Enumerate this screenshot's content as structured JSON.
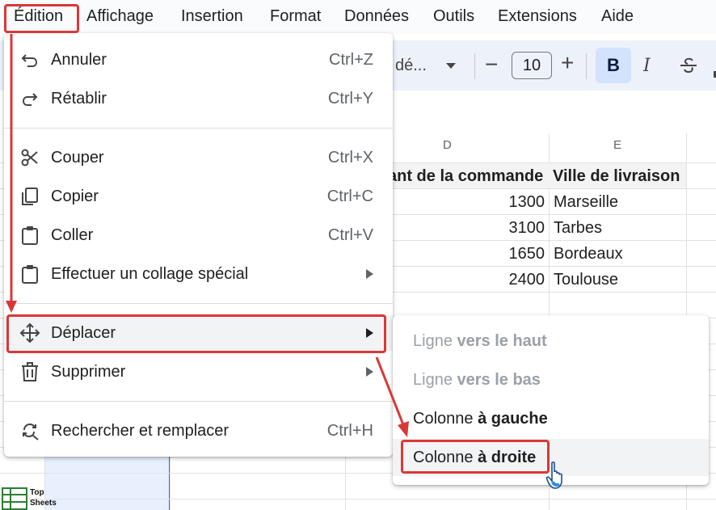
{
  "menubar": {
    "items": [
      "Édition",
      "Affichage",
      "Insertion",
      "Format",
      "Données",
      "Outils",
      "Extensions",
      "Aide"
    ]
  },
  "toolbar": {
    "font": "dé...",
    "font_size": "10",
    "bold": "B",
    "italic": "I"
  },
  "sheet": {
    "columns": [
      "D",
      "E"
    ],
    "header_row": [
      "ant de la commande",
      "Ville de livraison"
    ],
    "rows": [
      [
        "1300",
        "Marseille"
      ],
      [
        "3100",
        "Tarbes"
      ],
      [
        "1650",
        "Bordeaux"
      ],
      [
        "2400",
        "Toulouse"
      ]
    ]
  },
  "edit_menu": {
    "items": [
      {
        "label": "Annuler",
        "shortcut": "Ctrl+Z",
        "icon": "undo-icon"
      },
      {
        "label": "Rétablir",
        "shortcut": "Ctrl+Y",
        "icon": "redo-icon"
      },
      {
        "label": "Couper",
        "shortcut": "Ctrl+X",
        "icon": "scissors-icon"
      },
      {
        "label": "Copier",
        "shortcut": "Ctrl+C",
        "icon": "copy-icon"
      },
      {
        "label": "Coller",
        "shortcut": "Ctrl+V",
        "icon": "clipboard-icon"
      },
      {
        "label": "Effectuer un collage spécial",
        "shortcut": "",
        "icon": "clipboard-icon"
      },
      {
        "label": "Déplacer",
        "shortcut": "",
        "icon": "move-icon"
      },
      {
        "label": "Supprimer",
        "shortcut": "",
        "icon": "trash-icon"
      },
      {
        "label": "Rechercher et remplacer",
        "shortcut": "Ctrl+H",
        "icon": "find-replace-icon"
      }
    ]
  },
  "move_submenu": {
    "items": [
      {
        "prefix": "Ligne ",
        "bold": "vers le haut",
        "enabled": false
      },
      {
        "prefix": "Ligne ",
        "bold": "vers le bas",
        "enabled": false
      },
      {
        "prefix": "Colonne ",
        "bold": "à gauche",
        "enabled": true
      },
      {
        "prefix": "Colonne ",
        "bold": "à droite",
        "enabled": true
      }
    ]
  },
  "watermark": {
    "line1": "Top",
    "line2": "Sheets"
  },
  "colors": {
    "annotation": "#d93838",
    "menu_highlight": "#f1f3f4",
    "selection": "#1a73e8",
    "toolbar_bg": "#edf2fa",
    "bold_active": "#d3e3fd"
  }
}
